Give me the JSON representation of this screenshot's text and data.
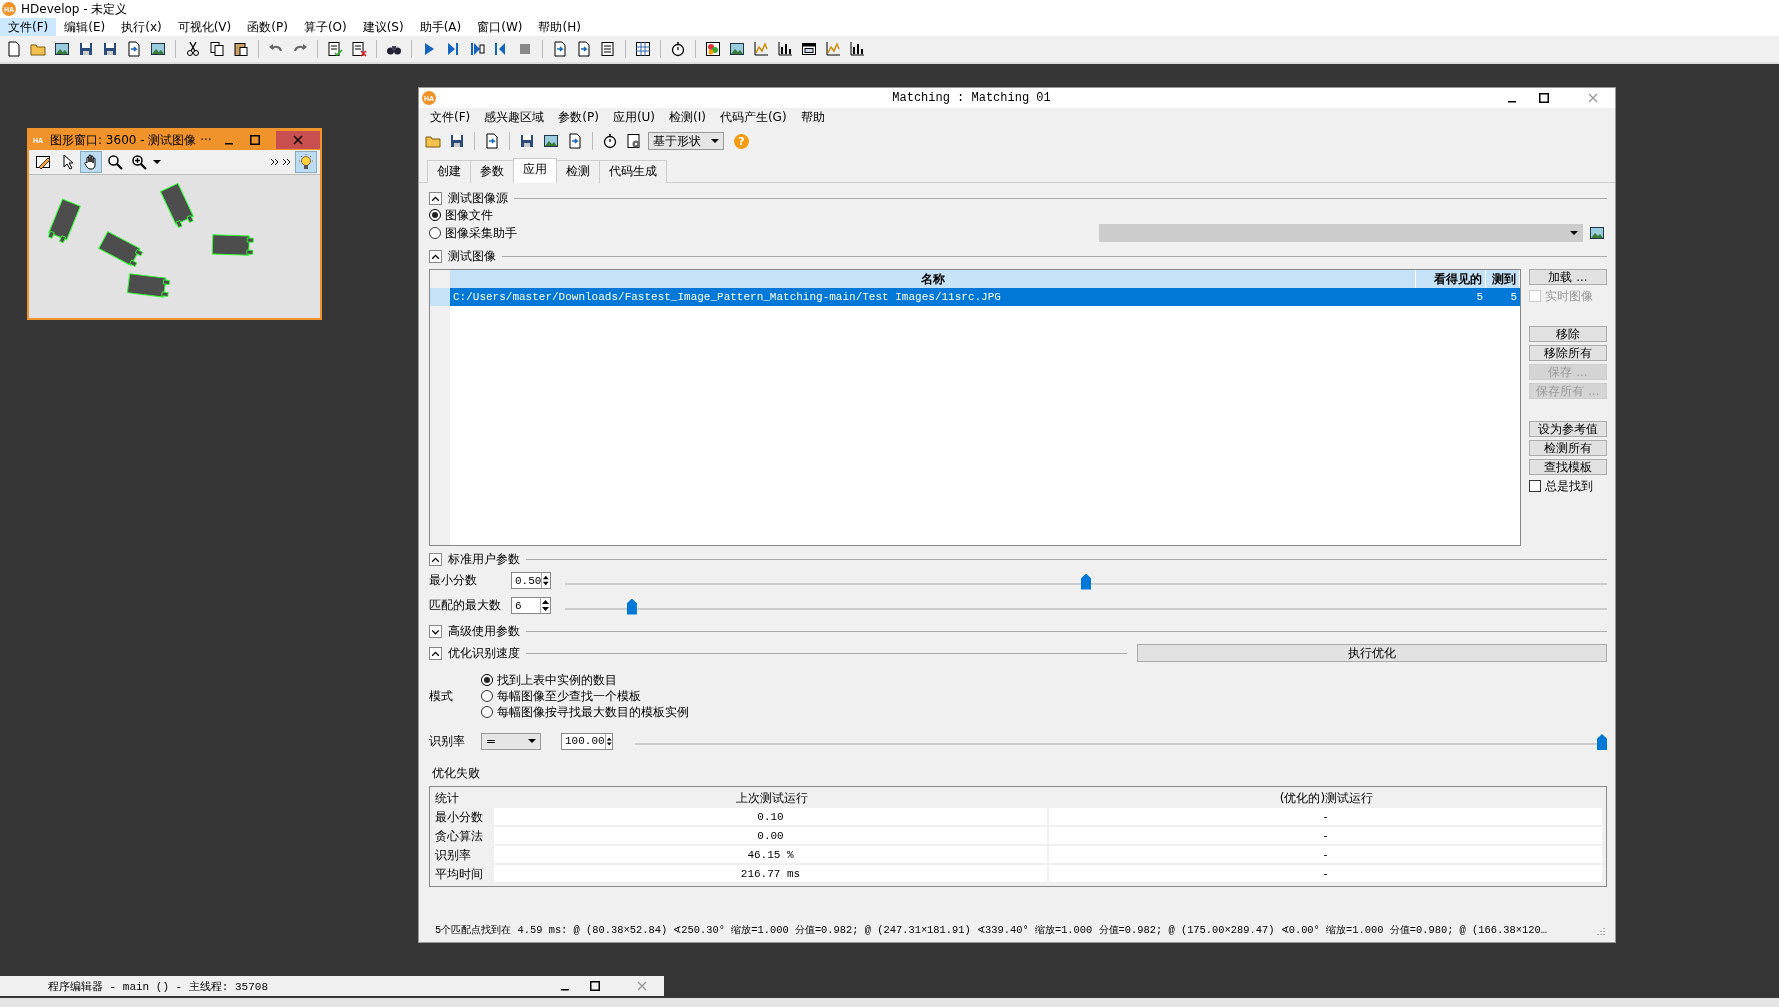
{
  "app": {
    "logo": "HA",
    "title": "HDevelop - 未定义"
  },
  "menu": [
    {
      "label": "文件(F)",
      "selected": true
    },
    {
      "label": "编辑(E)",
      "selected": false
    },
    {
      "label": "执行(x)",
      "selected": false
    },
    {
      "label": "可视化(V)",
      "selected": false
    },
    {
      "label": "函数(P)",
      "selected": false
    },
    {
      "label": "算子(O)",
      "selected": false
    },
    {
      "label": "建议(S)",
      "selected": false
    },
    {
      "label": "助手(A)",
      "selected": false
    },
    {
      "label": "窗口(W)",
      "selected": false
    },
    {
      "label": "帮助(H)",
      "selected": false
    }
  ],
  "graphics_window": {
    "logo": "HA",
    "title": "图形窗口: 3600 - 测试图像 ···",
    "tools": [
      {
        "kind": "edit",
        "selected": false
      },
      {
        "kind": "pointer",
        "selected": false
      },
      {
        "kind": "hand",
        "selected": true
      },
      {
        "kind": "zoom",
        "selected": false
      },
      {
        "kind": "zoom_in",
        "selected": false
      },
      {
        "kind": "bulb",
        "selected": true
      }
    ]
  },
  "matching_window": {
    "logo": "HA",
    "title": "Matching : Matching 01",
    "menu": [
      "文件(F)",
      "感兴趣区域",
      "参数(P)",
      "应用(U)",
      "检测(I)",
      "代码产生(G)",
      "帮助"
    ],
    "method": "基于形状",
    "help": "?",
    "tabs": [
      {
        "label": "创建",
        "selected": false
      },
      {
        "label": "参数",
        "selected": false
      },
      {
        "label": "应用",
        "selected": true
      },
      {
        "label": "检测",
        "selected": false
      },
      {
        "label": "代码生成",
        "selected": false
      }
    ],
    "source": {
      "title": "测试图像源",
      "expanded": true,
      "options": [
        {
          "label": "图像文件",
          "selected": true
        },
        {
          "label": "图像采集助手",
          "selected": false
        }
      ],
      "acquisition_dropdown": {
        "disabled": true
      }
    },
    "images": {
      "title": "测试图像",
      "expanded": true,
      "columns": [
        "名称",
        "看得见的",
        "测到"
      ],
      "rows": [
        {
          "cells": [
            "C:/Users/master/Downloads/Fastest_Image_Pattern_Matching-main/Test Images/11src.JPG",
            "5",
            "5"
          ],
          "selected": true
        }
      ],
      "side": [
        [
          {
            "kind": "button",
            "label": "加载 ...",
            "disabled": false
          },
          {
            "kind": "checkbox",
            "label": "实时图像",
            "checked": false,
            "disabled": true
          }
        ],
        [
          {
            "kind": "button",
            "label": "移除",
            "disabled": false
          },
          {
            "kind": "button",
            "label": "移除所有",
            "disabled": false
          },
          {
            "kind": "button",
            "label": "保存 ...",
            "disabled": true
          },
          {
            "kind": "button",
            "label": "保存所有 ...",
            "disabled": true
          }
        ],
        [
          {
            "kind": "button",
            "label": "设为参考值",
            "disabled": false
          },
          {
            "kind": "button",
            "label": "检测所有",
            "disabled": false
          },
          {
            "kind": "button",
            "label": "查找模板",
            "disabled": false
          },
          {
            "kind": "checkbox",
            "label": "总是找到",
            "checked": false,
            "disabled": false
          }
        ]
      ]
    },
    "standard_params": {
      "title": "标准用户参数",
      "expanded": true,
      "params": [
        {
          "label": "最小分数",
          "value": "0.50",
          "level": 0.5
        },
        {
          "label": "匹配的最大数",
          "value": "6",
          "level": 0.06
        }
      ]
    },
    "advanced_params": {
      "title": "高级使用参数",
      "expanded": false
    },
    "optimize": {
      "title": "优化识别速度",
      "expanded": true,
      "button": "执行优化",
      "mode_label": "模式",
      "modes": [
        {
          "label": "找到上表中实例的数目",
          "selected": true
        },
        {
          "label": "每幅图像至少查找一个模板",
          "selected": false
        },
        {
          "label": "每幅图像按寻找最大数目的模板实例",
          "selected": false
        }
      ],
      "rate_label": "识别率",
      "operator": "=",
      "rate": "100.00",
      "level": 1.0,
      "result": "优化失败",
      "stats": {
        "columns": [
          "统计",
          "上次测试运行",
          "(优化的)测试运行"
        ],
        "rows": [
          [
            "最小分数",
            "0.10",
            "-"
          ],
          [
            "贪心算法",
            "0.00",
            "-"
          ],
          [
            "识别率",
            "46.15 %",
            "-"
          ],
          [
            "平均时间",
            "216.77 ms",
            "-"
          ]
        ]
      }
    },
    "status": "5个匹配点找到在 4.59 ms: @ (80.38×52.84) ∢250.30°  缩放=1.000 分值=0.982; @ (247.31×181.91) ∢339.40°  缩放=1.000 分值=0.982; @ (175.00×289.47) ∢0.00°  缩放=1.000 分值=0.980; @ (166.38×120…"
  },
  "program_editor": {
    "title": "程序编辑器 - main () - 主线程: 35708"
  }
}
